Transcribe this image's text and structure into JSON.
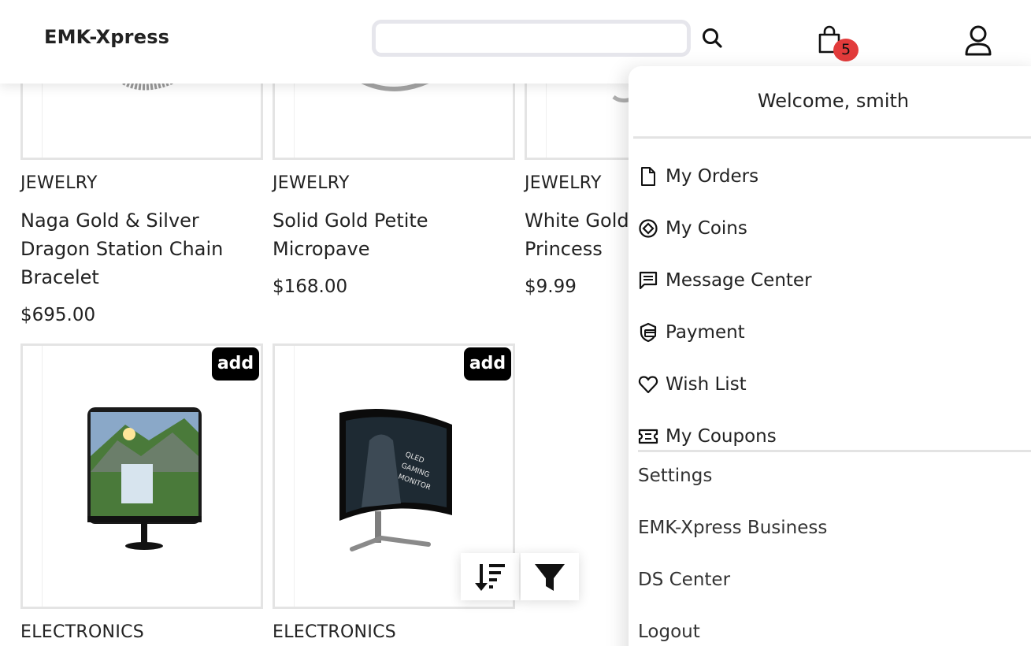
{
  "header": {
    "brand": "EMK-Xpress",
    "search_placeholder": "",
    "cart_count": "5"
  },
  "products": [
    {
      "category": "JEWELRY",
      "title": "Naga Gold & Silver Dragon Station Chain Bracelet",
      "price": "$695.00"
    },
    {
      "category": "JEWELRY",
      "title": "Solid Gold Petite Micropave",
      "price": "$168.00"
    },
    {
      "category": "JEWELRY",
      "title": "White Gold Princess",
      "price": "$9.99"
    },
    {
      "category": "ELECTRONICS",
      "add_label": "add"
    },
    {
      "category": "ELECTRONICS",
      "add_label": "add"
    }
  ],
  "user_menu": {
    "welcome": "Welcome, smith",
    "items": [
      {
        "label": "My Orders",
        "icon": "document-icon"
      },
      {
        "label": "My Coins",
        "icon": "coin-icon"
      },
      {
        "label": "Message Center",
        "icon": "message-icon"
      },
      {
        "label": "Payment",
        "icon": "payment-shield-icon"
      },
      {
        "label": "Wish List",
        "icon": "heart-icon"
      },
      {
        "label": "My Coupons",
        "icon": "coupon-icon"
      }
    ],
    "links": [
      "Settings",
      "EMK-Xpress Business",
      "DS Center",
      "Logout"
    ]
  },
  "toolbar": {
    "sort_icon": "sort-descending-icon",
    "filter_icon": "filter-icon"
  }
}
